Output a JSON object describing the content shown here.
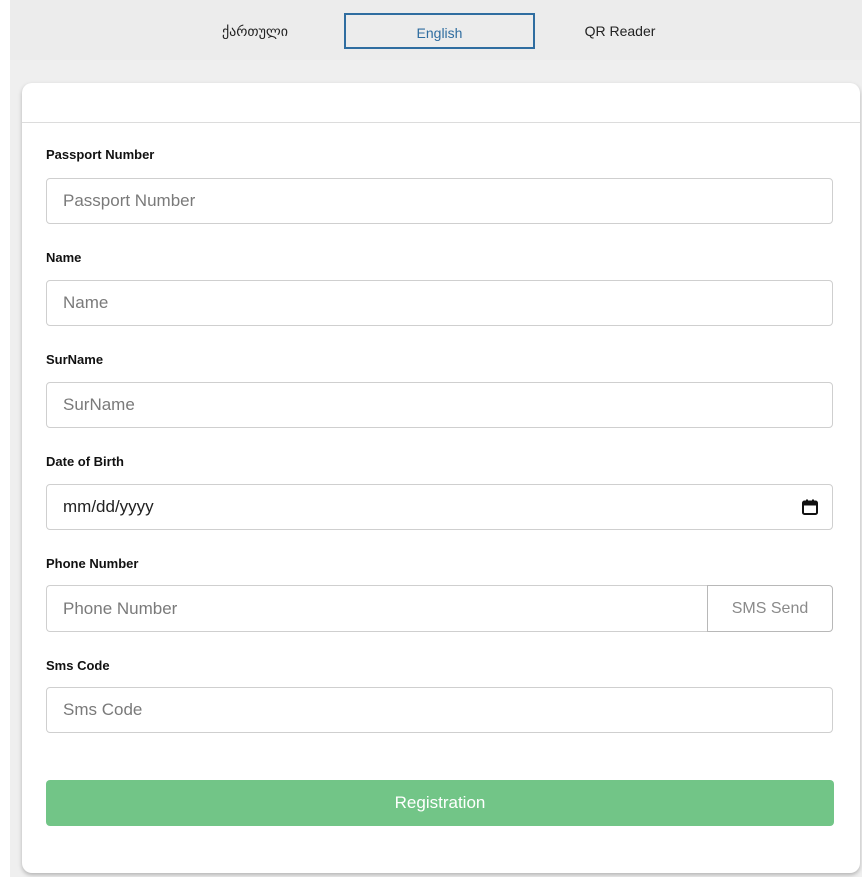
{
  "language_tabs": [
    {
      "label": "ქართული",
      "active": false
    },
    {
      "label": "English",
      "active": true
    },
    {
      "label": "QR Reader",
      "active": false
    }
  ],
  "form": {
    "passport": {
      "label": "Passport Number",
      "placeholder": "Passport Number"
    },
    "name": {
      "label": "Name",
      "placeholder": "Name"
    },
    "surname": {
      "label": "SurName",
      "placeholder": "SurName"
    },
    "dob": {
      "label": "Date of Birth",
      "placeholder": "mm/dd/yyyy"
    },
    "phone": {
      "label": "Phone Number",
      "placeholder": "Phone Number",
      "sms_button": "SMS Send"
    },
    "sms_code": {
      "label": "Sms Code",
      "placeholder": "Sms Code"
    },
    "submit_label": "Registration"
  },
  "colors": {
    "active_tab_border": "#2f6da0",
    "submit_button": "#72c587",
    "background": "#efefef"
  },
  "icons": {
    "date_picker": "calendar-icon"
  }
}
